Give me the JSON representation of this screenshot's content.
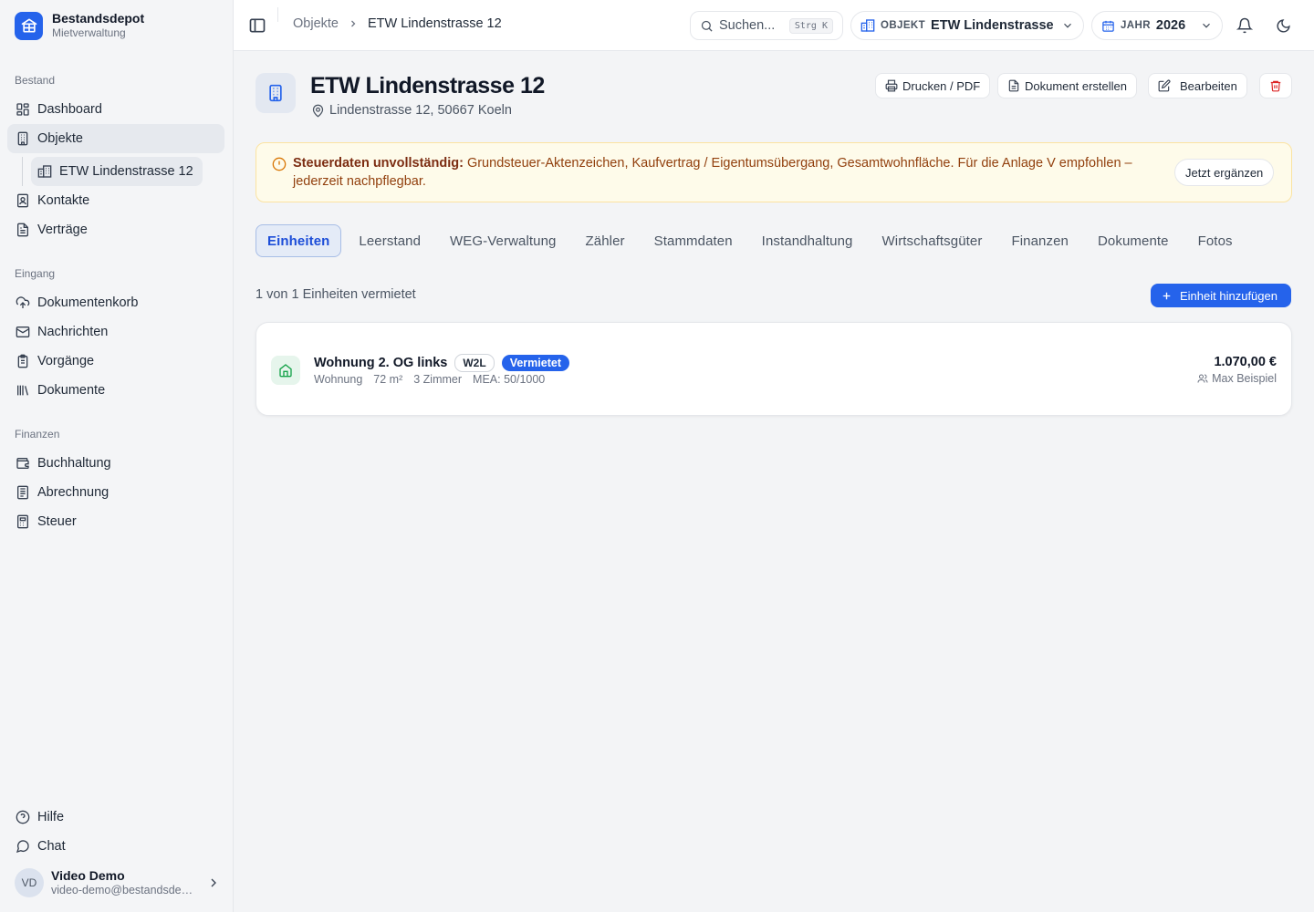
{
  "sidebar": {
    "brand": {
      "title": "Bestandsdepot",
      "subtitle": "Mietverwaltung"
    },
    "sections": [
      {
        "label": "Bestand",
        "items": [
          {
            "label": "Dashboard",
            "icon": "dashboard-icon"
          },
          {
            "label": "Objekte",
            "icon": "building-icon",
            "active": true
          },
          {
            "label": "Kontakte",
            "icon": "contact-book-icon"
          },
          {
            "label": "Verträge",
            "icon": "contract-icon"
          }
        ]
      },
      {
        "label": "Eingang",
        "items": [
          {
            "label": "Dokumentenkorb",
            "icon": "cloud-upload-icon"
          },
          {
            "label": "Nachrichten",
            "icon": "mail-icon"
          },
          {
            "label": "Vorgänge",
            "icon": "clipboard-icon"
          },
          {
            "label": "Dokumente",
            "icon": "library-icon"
          }
        ]
      },
      {
        "label": "Finanzen",
        "items": [
          {
            "label": "Buchhaltung",
            "icon": "wallet-icon"
          },
          {
            "label": "Abrechnung",
            "icon": "receipt-icon"
          },
          {
            "label": "Steuer",
            "icon": "calculator-icon"
          }
        ]
      }
    ],
    "sub_item": {
      "label": "ETW Lindenstrasse 12",
      "icon": "apartment-building-icon"
    },
    "footer": [
      {
        "label": "Hilfe",
        "icon": "help-circle-icon"
      },
      {
        "label": "Chat",
        "icon": "chat-bubble-icon"
      }
    ],
    "user": {
      "initials": "VD",
      "name": "Video Demo",
      "email": "video-demo@bestandsdepot.de"
    }
  },
  "topbar": {
    "breadcrumb": {
      "parent": "Objekte",
      "current": "ETW Lindenstrasse 12"
    },
    "search": {
      "placeholder": "Suchen...",
      "shortcut": "Strg K"
    },
    "object_selector": {
      "label": "OBJEKT",
      "value": "ETW Lindenstrasse"
    },
    "year_selector": {
      "label": "JAHR",
      "value": "2026"
    }
  },
  "header": {
    "title": "ETW Lindenstrasse 12",
    "address": "Lindenstrasse 12, 50667 Koeln",
    "actions": {
      "print": "Drucken / PDF",
      "create_doc": "Dokument erstellen",
      "edit": "Bearbeiten"
    }
  },
  "warning": {
    "title": "Steuerdaten unvollständig:",
    "text": "Grundsteuer-Aktenzeichen, Kaufvertrag / Eigentumsübergang, Gesamtwohnfläche. Für die Anlage V empfohlen – jederzeit nachpflegbar.",
    "button": "Jetzt ergänzen"
  },
  "tabs": [
    "Einheiten",
    "Leerstand",
    "WEG-Verwaltung",
    "Zähler",
    "Stammdaten",
    "Instandhaltung",
    "Wirtschaftsgüter",
    "Finanzen",
    "Dokumente",
    "Fotos"
  ],
  "units_summary": "1 von 1 Einheiten vermietet",
  "add_unit_button": "Einheit hinzufügen",
  "unit": {
    "name": "Wohnung 2. OG links",
    "code": "W2L",
    "status": "Vermietet",
    "type": "Wohnung",
    "area": "72 m²",
    "rooms": "3 Zimmer",
    "mea": "MEA: 50/1000",
    "rent": "1.070,00 €",
    "tenant": "Max Beispiel"
  },
  "colors": {
    "accent": "#2563eb",
    "warning_bg": "#fefbea",
    "warning_text": "#92400e",
    "success": "#16a34a",
    "danger": "#dc2626"
  }
}
